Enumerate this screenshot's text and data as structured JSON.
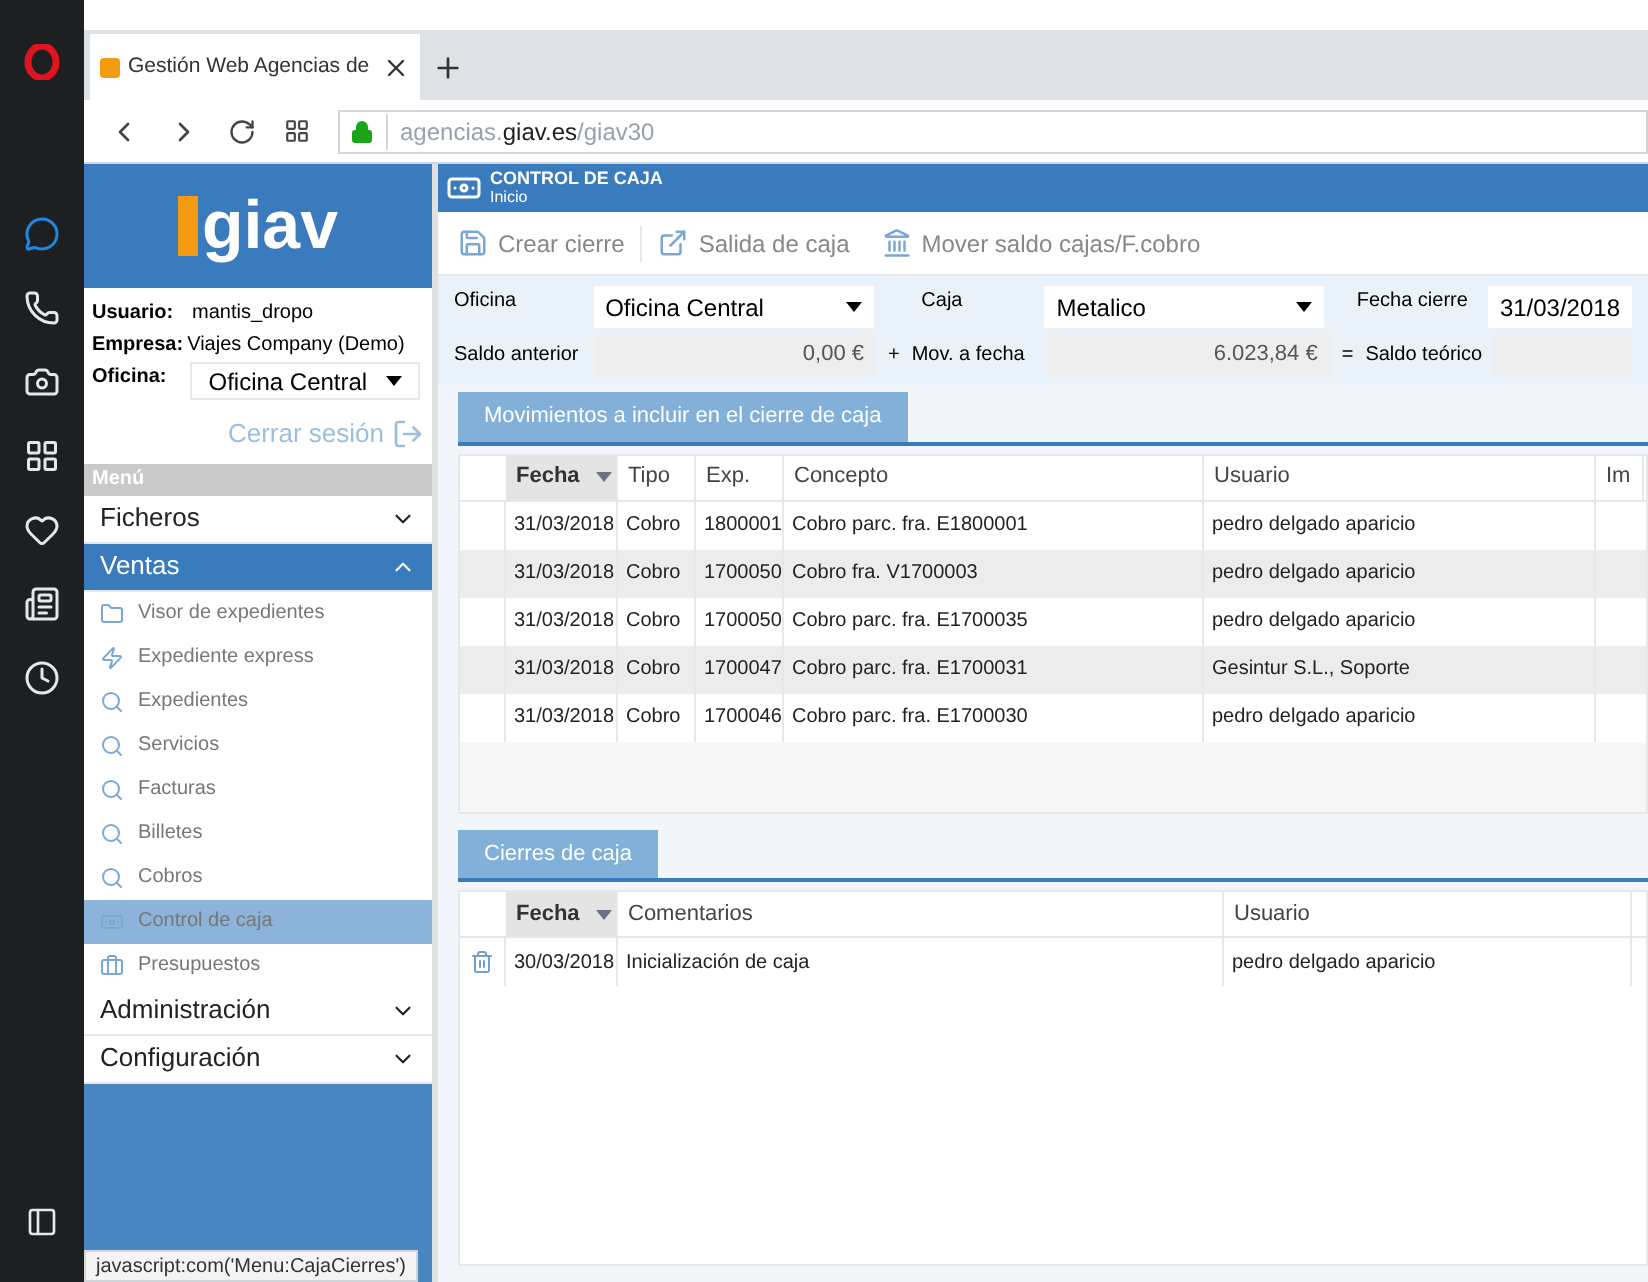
{
  "browser": {
    "tab_title": "Gestión Web Agencias de",
    "url": {
      "prefix": "agencias.",
      "domain": "giav.es",
      "path": "/giav30"
    }
  },
  "sidebar": {
    "logo": "giav",
    "user_label": "Usuario:",
    "user": "mantis_dropo",
    "company_label": "Empresa:",
    "company": "Viajes Company (Demo)",
    "office_label": "Oficina:",
    "office": "Oficina Central",
    "logout": "Cerrar sesión",
    "menu_label": "Menú",
    "sections": [
      {
        "label": "Ficheros",
        "expanded": false
      },
      {
        "label": "Ventas",
        "expanded": true,
        "items": [
          {
            "label": "Visor de expedientes",
            "kind": "folder",
            "selected": false
          },
          {
            "label": "Expediente express",
            "kind": "bolt",
            "selected": false
          },
          {
            "label": "Expedientes",
            "kind": "search",
            "selected": false
          },
          {
            "label": "Servicios",
            "kind": "search",
            "selected": false
          },
          {
            "label": "Facturas",
            "kind": "search",
            "selected": false
          },
          {
            "label": "Billetes",
            "kind": "search",
            "selected": false
          },
          {
            "label": "Cobros",
            "kind": "search",
            "selected": false
          },
          {
            "label": "Control de caja",
            "kind": "money",
            "selected": true
          },
          {
            "label": "Presupuestos",
            "kind": "briefcase",
            "selected": false
          }
        ]
      },
      {
        "label": "Administración",
        "expanded": false
      },
      {
        "label": "Configuración",
        "expanded": false
      }
    ]
  },
  "page": {
    "title": "CONTROL DE CAJA",
    "subtitle": "Inicio",
    "toolbar": [
      {
        "label": "Crear cierre",
        "kind": "save"
      },
      {
        "label": "Salida de caja",
        "kind": "external"
      },
      {
        "label": "Mover saldo cajas/F.cobro",
        "kind": "bank"
      }
    ],
    "form": {
      "office_label": "Oficina",
      "office": "Oficina Central",
      "box_label": "Caja",
      "box": "Metalico",
      "date_label": "Fecha cierre",
      "date": "31/03/2018",
      "prev_label": "Saldo anterior",
      "prev": "0,00 €",
      "plus": "+",
      "mov_label": "Mov. a fecha",
      "mov": "6.023,84 €",
      "equals": "=",
      "theory_label": "Saldo teórico"
    },
    "movements": {
      "tab": "Movimientos a incluir en el cierre de caja",
      "columns": [
        {
          "label": "Fecha",
          "sorted": true
        },
        {
          "label": "Tipo",
          "sorted": false
        },
        {
          "label": "Exp.",
          "sorted": false
        },
        {
          "label": "Concepto",
          "sorted": false
        },
        {
          "label": "Usuario",
          "sorted": false
        },
        {
          "label": "Im",
          "sorted": false
        }
      ],
      "rows": [
        [
          "31/03/2018",
          "Cobro",
          "1800001",
          "Cobro parc. fra. E1800001",
          "pedro delgado aparicio"
        ],
        [
          "31/03/2018",
          "Cobro",
          "1700050",
          "Cobro fra. V1700003",
          "pedro delgado aparicio"
        ],
        [
          "31/03/2018",
          "Cobro",
          "1700050",
          "Cobro parc. fra. E1700035",
          "pedro delgado aparicio"
        ],
        [
          "31/03/2018",
          "Cobro",
          "1700047",
          "Cobro parc. fra. E1700031",
          "Gesintur S.L., Soporte"
        ],
        [
          "31/03/2018",
          "Cobro",
          "1700046",
          "Cobro parc. fra. E1700030",
          "pedro delgado aparicio"
        ]
      ]
    },
    "closures": {
      "tab": "Cierres de caja",
      "columns": [
        {
          "label": "Fecha",
          "sorted": true
        },
        {
          "label": "Comentarios",
          "sorted": false
        },
        {
          "label": "Usuario",
          "sorted": false
        }
      ],
      "rows": [
        [
          "30/03/2018",
          "Inicialización de caja",
          "pedro delgado aparicio"
        ]
      ]
    }
  },
  "status_bar": "javascript:com('Menu:CajaCierres')"
}
